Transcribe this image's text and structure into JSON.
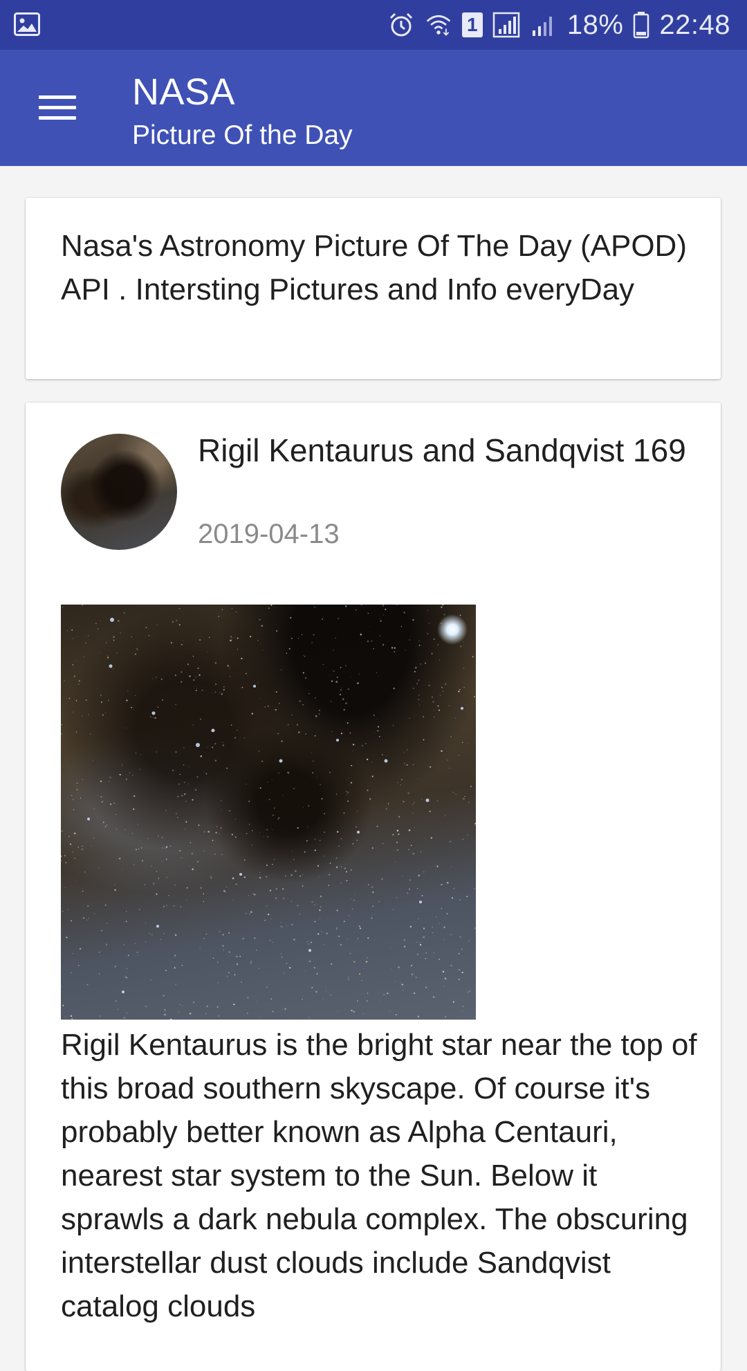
{
  "status_bar": {
    "icons": [
      "gallery-icon",
      "alarm-icon",
      "wifi-icon",
      "sim1-badge-icon",
      "signal-icon",
      "signal-weak-icon",
      "battery-icon"
    ],
    "sim_badge": "1",
    "battery_percent": "18%",
    "time": "22:48",
    "color": "#303f9f"
  },
  "app_bar": {
    "title": "NASA",
    "subtitle": "Picture Of the Day",
    "menu_icon": "hamburger-menu-icon",
    "color": "#3f51b5"
  },
  "intro": {
    "text": "Nasa's Astronomy Picture Of The Day (APOD) API . Intersting Pictures and Info everyDay"
  },
  "apod": {
    "title": "Rigil Kentaurus and Sandqvist 169",
    "date": "2019-04-13",
    "description": "Rigil Kentaurus is the bright star near the top of this broad southern skyscape. Of course it's probably better known as Alpha Centauri, nearest star system to the Sun. Below it sprawls a dark nebula complex. The obscuring interstellar dust clouds include Sandqvist catalog clouds"
  }
}
